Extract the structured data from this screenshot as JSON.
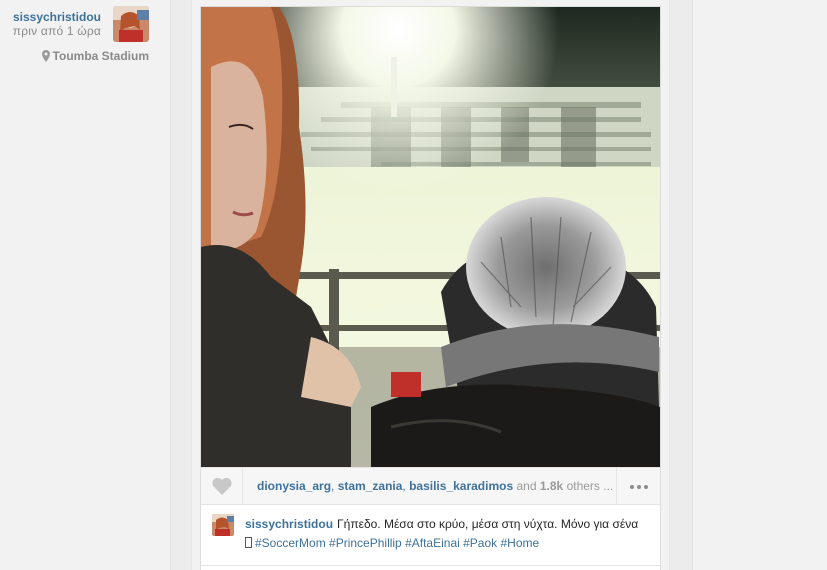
{
  "post": {
    "username": "sissychristidou",
    "timestamp": "πριν από 1 ώρα",
    "location": "Toumba Stadium"
  },
  "likes": {
    "likers": [
      "dionysia_arg",
      "stam_zania",
      "basilis_karadimos"
    ],
    "and_label": "and",
    "count": "1.8k",
    "others_label": "others ..."
  },
  "caption": {
    "username": "sissychristidou",
    "text": "Γήπεδο. Μέσα στο κρύο, μέσα στη νύχτα. Μόνο για σένα",
    "hashtags": [
      "#SoccerMom",
      "#PrincePhillip",
      "#AftaEinai",
      "#Paok",
      "#Home"
    ]
  },
  "icons": {
    "heart": "heart-icon",
    "more": "more-options-icon",
    "pin": "location-pin-icon"
  },
  "colors": {
    "link": "#3f729b",
    "muted": "#999999",
    "background": "#f2f2f2"
  }
}
